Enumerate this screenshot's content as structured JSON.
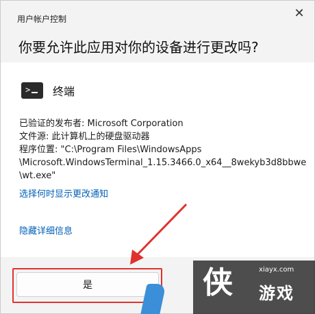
{
  "dialog": {
    "caption": "用户帐户控制",
    "close_glyph": "✕",
    "question": "你要允许此应用对你的设备进行更改吗?"
  },
  "app": {
    "name": "终端",
    "icon": "terminal-icon",
    "icon_glyph": ">"
  },
  "details": {
    "publisher": "已验证的发布者: Microsoft Corporation",
    "file_origin": "文件源: 此计算机上的硬盘驱动器",
    "program_location_1": "程序位置: \"C:\\Program Files\\WindowsApps",
    "program_location_2": "\\Microsoft.WindowsTerminal_1.15.3466.0_x64__8wekyb3d8bbwe",
    "program_location_3": "\\wt.exe\""
  },
  "links": {
    "show_settings": "选择何时显示更改通知",
    "hide_details": "隐藏详细信息"
  },
  "buttons": {
    "yes": "是"
  },
  "watermark": {
    "site": "xiayx.com",
    "glyph": "侠",
    "title": "游戏"
  },
  "colors": {
    "header_bg": "#f3f3f3",
    "link": "#005fb8",
    "highlight": "#e0312e"
  }
}
